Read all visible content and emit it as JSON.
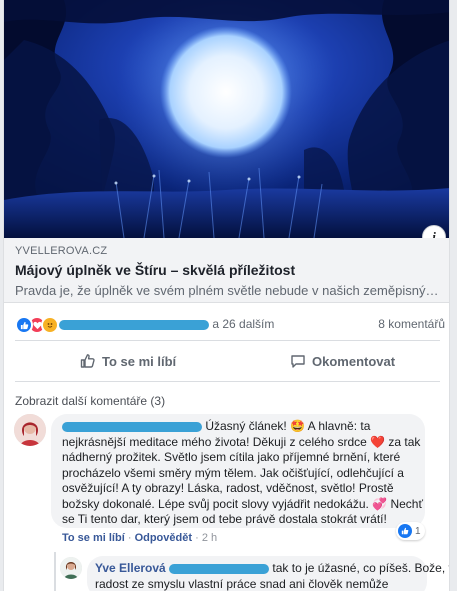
{
  "link_preview": {
    "domain": "YVELLEROVA.CZ",
    "title": "Májový úplněk ve Štíru – skvělá příležitost",
    "description": "Pravda je, že úplněk ve svém plném světle nebude v našich zeměpisných…"
  },
  "reactions": {
    "names_visible_end": "a 26 dalším",
    "comment_count": "8 komentářů"
  },
  "actions": {
    "like_label": "To se mi líbí",
    "comment_label": "Okomentovat"
  },
  "comments_section": {
    "more_comments_label": "Zobrazit další komentáře (3)",
    "comments": [
      {
        "text_lines": [
          "Úžasný článek! 🤩 A hlavně: ta",
          "nejkrásnější meditace mého života! Děkuji z celého srdce ❤️ za tak",
          "nádherný prožitek. Světlo jsem cítila jako příjemné brnění, které",
          "procházelo všemi směry mým tělem. Jak očišťující, odlehčující a",
          "osvěžující! A ty obrazy! Láska, radost, vděčnost, světlo! Prostě",
          "božsky dokonalé. Lépe svůj pocit slovy vyjádřit nedokážu. 💞 Nechť",
          "se Ti tento dar, který jsem od tebe právě dostala stokrát vrátí!"
        ],
        "like_count": "1",
        "like_action": "To se mi líbí",
        "reply_action": "Odpovědět",
        "time": "2 h"
      }
    ],
    "reply": {
      "author": "Yve Ellerová",
      "line1": "tak to je úžasné, co píšeš. Bože, větší",
      "line2": "radost ze smyslu vlastní práce snad ani člověk nemůže"
    }
  },
  "icons": [
    "info-icon",
    "like-reaction-icon",
    "love-reaction-icon",
    "care-reaction-icon",
    "thumb-up-icon",
    "comment-bubble-icon"
  ],
  "colors": {
    "facebook_blue": "#1877f2",
    "link_blue": "#385898",
    "love_red": "#f33e58",
    "care_yellow": "#f7b125",
    "redaction_blue": "#3aa1d6"
  }
}
